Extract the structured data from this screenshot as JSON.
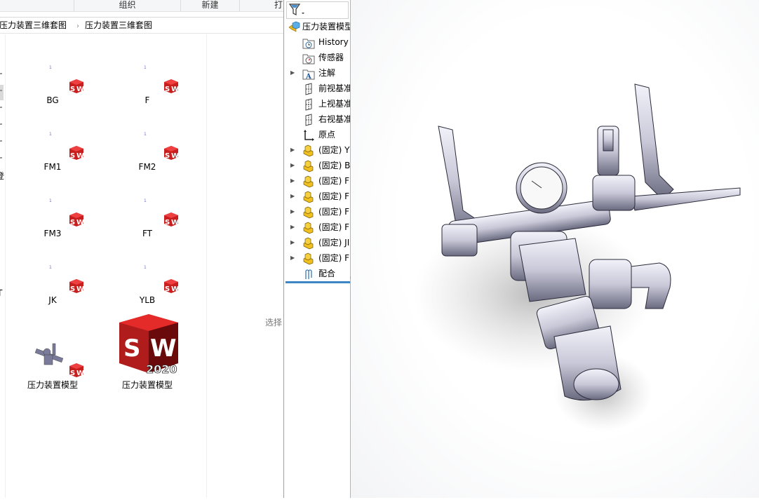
{
  "explorer": {
    "ribbon": {
      "organize": "组织",
      "new": "新建",
      "open": "打"
    },
    "breadcrumb": [
      "压力装置三维套图",
      "压力装置三维套图"
    ],
    "nav_fragments": [
      "登",
      "T"
    ],
    "files": [
      {
        "name": "BG",
        "thumb_text": "1"
      },
      {
        "name": "F",
        "thumb_text": "1"
      },
      {
        "name": "FM1",
        "thumb_text": "1"
      },
      {
        "name": "FM2",
        "thumb_text": "1"
      },
      {
        "name": "FM3",
        "thumb_text": "1"
      },
      {
        "name": "FT",
        "thumb_text": "1"
      },
      {
        "name": "JK",
        "thumb_text": "1"
      },
      {
        "name": "YLB",
        "thumb_text": "1"
      },
      {
        "name": "压力装置模型"
      },
      {
        "name": "压力装置模型",
        "badge": "2020"
      }
    ],
    "preview_hint": "选择"
  },
  "feature_manager": {
    "root": "压力装置模型",
    "items": [
      {
        "label": "History",
        "icon": "history-folder-icon",
        "expandable": false
      },
      {
        "label": "传感器",
        "icon": "sensor-folder-icon",
        "expandable": false
      },
      {
        "label": "注解",
        "icon": "annotation-folder-icon",
        "expandable": true
      },
      {
        "label": "前视基准",
        "icon": "plane-icon",
        "expandable": false
      },
      {
        "label": "上视基准",
        "icon": "plane-icon",
        "expandable": false
      },
      {
        "label": "右视基准",
        "icon": "plane-icon",
        "expandable": false
      },
      {
        "label": "原点",
        "icon": "origin-icon",
        "expandable": false
      },
      {
        "label": "(固定) Y",
        "icon": "part-icon",
        "expandable": true
      },
      {
        "label": "(固定) B",
        "icon": "part-icon",
        "expandable": true
      },
      {
        "label": "(固定) F",
        "icon": "part-icon",
        "expandable": true
      },
      {
        "label": "(固定) F",
        "icon": "part-icon",
        "expandable": true
      },
      {
        "label": "(固定) F",
        "icon": "part-icon",
        "expandable": true
      },
      {
        "label": "(固定) F",
        "icon": "part-icon",
        "expandable": true
      },
      {
        "label": "(固定) JI",
        "icon": "part-icon",
        "expandable": true
      },
      {
        "label": "(固定) F",
        "icon": "part-icon",
        "expandable": true
      },
      {
        "label": "配合",
        "icon": "mates-icon",
        "expandable": false
      }
    ]
  },
  "colors": {
    "sw_red": "#d22b2b",
    "part_yellow": "#f0c020",
    "accent": "#3d86c6"
  }
}
